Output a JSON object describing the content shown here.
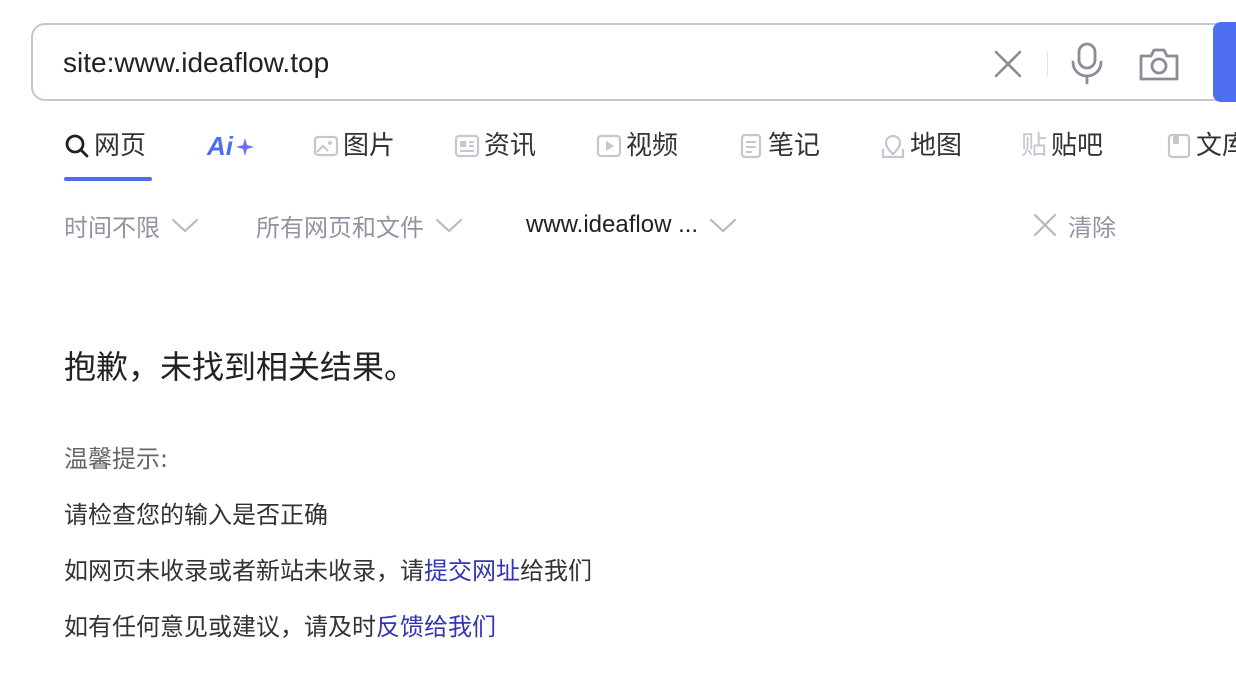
{
  "search": {
    "query": "site:www.ideaflow.top",
    "clear_icon": "close-icon",
    "mic_icon": "microphone-icon",
    "camera_icon": "camera-icon"
  },
  "tabs": [
    {
      "label": "网页",
      "icon": "search-icon",
      "active": true
    },
    {
      "label": "",
      "icon": "ai-icon",
      "brand_text": "Ai"
    },
    {
      "label": "图片",
      "icon": "image-icon"
    },
    {
      "label": "资讯",
      "icon": "news-icon"
    },
    {
      "label": "视频",
      "icon": "video-icon"
    },
    {
      "label": "笔记",
      "icon": "note-icon"
    },
    {
      "label": "地图",
      "icon": "map-icon"
    },
    {
      "label": "贴吧",
      "icon": "tieba-icon",
      "icon_text": "贴"
    },
    {
      "label": "文库",
      "icon": "doc-icon"
    }
  ],
  "filters": {
    "time": "时间不限",
    "type": "所有网页和文件",
    "site": "www.ideaflow ...",
    "clear": "清除"
  },
  "result": {
    "title": "抱歉，未找到相关结果。",
    "tips_heading": "温馨提示:",
    "tip1": "请检查您的输入是否正确",
    "tip2_prefix": "如网页未收录或者新站未收录，请",
    "tip2_link": "提交网址",
    "tip2_suffix": "给我们",
    "tip3_prefix": "如有任何意见或建议，请及时",
    "tip3_link": "反馈给我们"
  },
  "colors": {
    "accent": "#4e6ef2",
    "link": "#3336b2",
    "muted": "#9195a3",
    "icon": "#c4c7ce"
  }
}
